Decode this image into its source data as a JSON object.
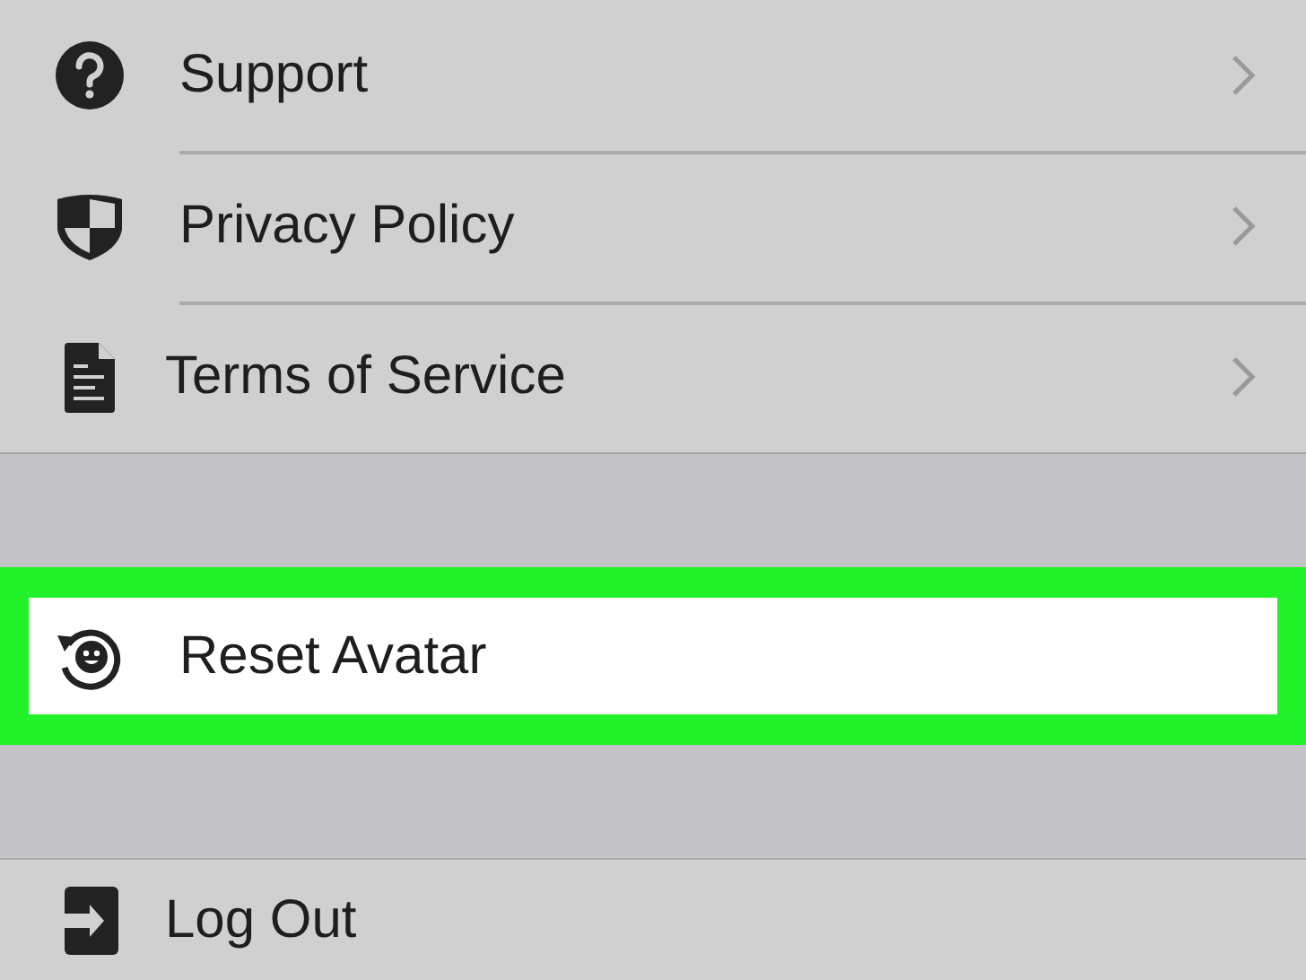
{
  "sections": [
    {
      "items": [
        {
          "kind": "help",
          "label": "Support",
          "chevron": true,
          "highlighted": false
        },
        {
          "kind": "shield",
          "label": "Privacy Policy",
          "chevron": true,
          "highlighted": false
        },
        {
          "kind": "document",
          "label": "Terms of Service",
          "chevron": true,
          "highlighted": false
        }
      ]
    },
    {
      "items": [
        {
          "kind": "reset",
          "label": "Reset Avatar",
          "chevron": false,
          "highlighted": true
        }
      ]
    },
    {
      "items": [
        {
          "kind": "logout",
          "label": "Log Out",
          "chevron": false,
          "highlighted": false
        }
      ]
    }
  ]
}
